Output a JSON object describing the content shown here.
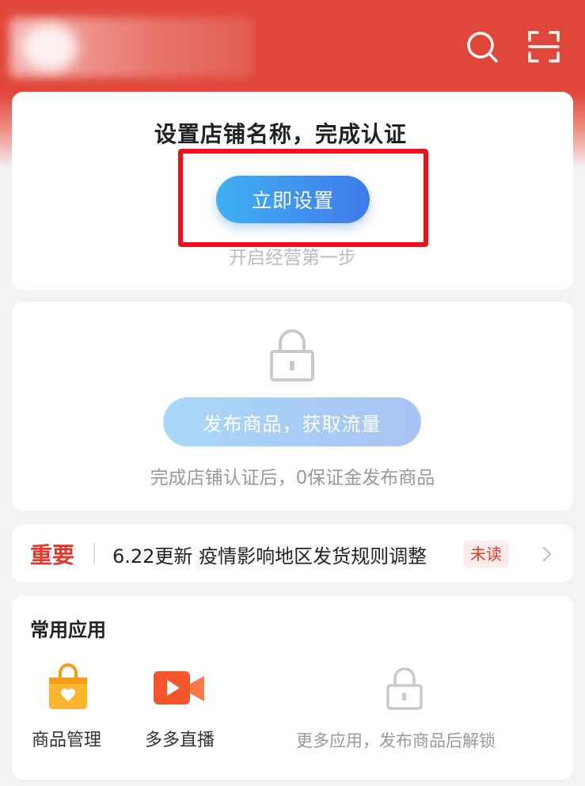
{
  "header": {
    "icons": [
      "search-icon",
      "scan-icon"
    ]
  },
  "setup_card": {
    "title": "设置店铺名称，完成认证",
    "button_label": "立即设置",
    "subtitle": "开启经营第一步"
  },
  "publish_card": {
    "button_label": "发布商品，获取流量",
    "subtitle": "完成店铺认证后，0保证金发布商品"
  },
  "notice": {
    "tag": "重要",
    "text": "6.22更新 疫情影响地区发货规则调整",
    "badge": "未读"
  },
  "apps": {
    "title": "常用应用",
    "items": [
      {
        "label": "商品管理",
        "icon": "shopping-bag-icon"
      },
      {
        "label": "多多直播",
        "icon": "video-camera-icon"
      }
    ],
    "locked_text": "更多应用，发布商品后解锁"
  },
  "colors": {
    "brand_red": "#e0473a",
    "primary_blue": "#3f7ae9",
    "highlight_box": "#f0101a"
  }
}
